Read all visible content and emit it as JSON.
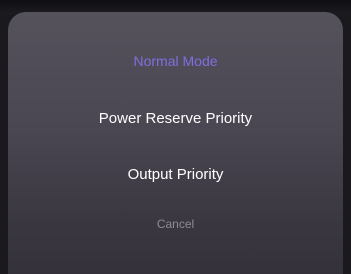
{
  "mode_sheet": {
    "options": [
      {
        "label": "Normal Mode",
        "selected": true
      },
      {
        "label": "Power Reserve Priority",
        "selected": false
      },
      {
        "label": "Output Priority",
        "selected": false
      }
    ],
    "cancel_label": "Cancel",
    "colors": {
      "selected_text": "#7f6fe0",
      "option_text": "#ffffff",
      "cancel_text": "#8f8b96",
      "sheet_background": "#4a4652"
    }
  }
}
